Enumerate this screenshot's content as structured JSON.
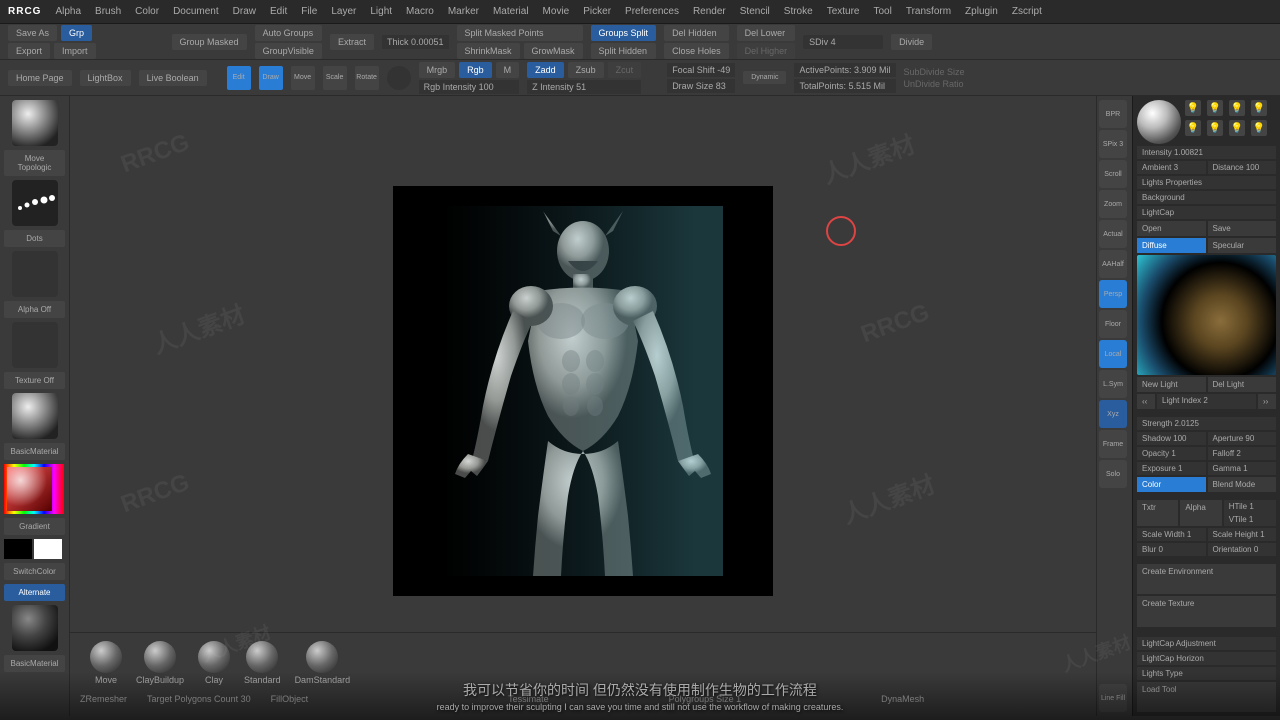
{
  "logo": "RRCG",
  "menu": [
    "Alpha",
    "Brush",
    "Color",
    "Document",
    "Draw",
    "Edit",
    "File",
    "Layer",
    "Light",
    "Macro",
    "Marker",
    "Material",
    "Movie",
    "Picker",
    "Preferences",
    "Render",
    "Stencil",
    "Stroke",
    "Texture",
    "Tool",
    "Transform",
    "Zplugin",
    "Zscript"
  ],
  "toolbar1": {
    "saveAs": "Save As",
    "grp": "Grp",
    "export": "Export",
    "import": "Import",
    "groupMasked": "Group Masked",
    "autoGroups": "Auto Groups",
    "groupVisible": "GroupVisible",
    "extract": "Extract",
    "thick": "Thick 0.00051",
    "splitMasked": "Split Masked Points",
    "shrinkMask": "ShrinkMask",
    "growMask": "GrowMask",
    "groupsSplit": "Groups Split",
    "splitHidden": "Split Hidden",
    "delHidden": "Del Hidden",
    "closeHoles": "Close Holes",
    "delLower": "Del Lower",
    "delHigher": "Del Higher",
    "sdiv": "SDiv 4",
    "divide": "Divide"
  },
  "toolbar2": {
    "homePage": "Home Page",
    "lightBox": "LightBox",
    "liveBoolean": "Live Boolean",
    "edit": "Edit",
    "draw": "Draw",
    "move": "Move",
    "scale": "Scale",
    "rotate": "Rotate",
    "mrgb": "Mrgb",
    "rgb": "Rgb",
    "m": "M",
    "rgbIntensity": "Rgb Intensity 100",
    "zadd": "Zadd",
    "zsub": "Zsub",
    "zcut": "Zcut",
    "zIntensity": "Z Intensity 51",
    "focalShift": "Focal Shift -49",
    "drawSize": "Draw Size 83",
    "dynamic": "Dynamic",
    "activePoints": "ActivePoints: 3.909 Mil",
    "totalPoints": "TotalPoints: 5.515 Mil",
    "subDivideSize": "SubDivide Size",
    "unDivideRatio": "UnDivide Ratio"
  },
  "left": {
    "moveTopo": "Move Topologic",
    "dots": "Dots",
    "alphaOff": "Alpha Off",
    "textureOff": "Texture Off",
    "basicMaterial": "BasicMaterial",
    "gradient": "Gradient",
    "switchColor": "SwitchColor",
    "alternate": "Alternate",
    "zremesher": "ZRemesher"
  },
  "rightTools": [
    "BPR",
    "SPix 3",
    "Scroll",
    "Zoom",
    "Actual",
    "AAHalf",
    "Persp",
    "Floor",
    "Local",
    "L.Sym",
    "Xyz",
    "Frame",
    "Solo",
    "Line Fill"
  ],
  "rightPanel": {
    "intensity": "Intensity 1.00821",
    "ambient": "Ambient 3",
    "distance": "Distance 100",
    "lightsProps": "Lights Properties",
    "background": "Background",
    "lightCap": "LightCap",
    "open": "Open",
    "save": "Save",
    "diffuse": "Diffuse",
    "specular": "Specular",
    "newLight": "New Light",
    "delLight": "Del Light",
    "lightIndex": "Light Index 2",
    "strength": "Strength 2.0125",
    "shadow": "Shadow 100",
    "aperture": "Aperture 90",
    "opacity": "Opacity 1",
    "falloff": "Falloff 2",
    "exposure": "Exposure 1",
    "gamma": "Gamma 1",
    "color": "Color",
    "blendMode": "Blend Mode",
    "txtr": "Txtr",
    "alpha": "Alpha",
    "htile": "HTile 1",
    "vtile": "VTile 1",
    "scaleWidth": "Scale Width 1",
    "scaleHeight": "Scale Height 1",
    "blur": "Blur 0",
    "orientation": "Orientation 0",
    "createEnv": "Create Environment",
    "createTex": "Create Texture",
    "lcAdjust": "LightCap Adjustment",
    "lcHorizon": "LightCap Horizon",
    "lightsType": "Lights Type",
    "loadTool": "Load Tool"
  },
  "brushes": [
    "Move",
    "ClayBuildup",
    "Clay",
    "Standard",
    "DamStandard"
  ],
  "bottomBar": {
    "targetPoly": "Target Polygons Count 30",
    "fillObject": "FillObject",
    "tessimate": "Tessimate",
    "polygroupsSize": "Polygroups Size 1",
    "dynaMesh": "DynaMesh"
  },
  "subtitle": {
    "cn": "我可以节省你的时间 但仍然没有使用制作生物的工作流程",
    "en": "ready to improve their sculpting I can save you time and still not use the workflow of making creatures."
  }
}
